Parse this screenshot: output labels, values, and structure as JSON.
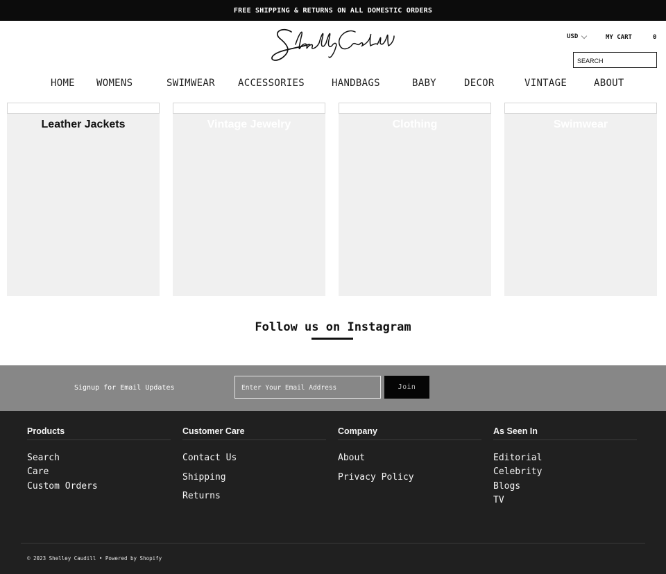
{
  "announcement": "FREE SHIPPING & RETURNS ON ALL DOMESTIC ORDERS",
  "header": {
    "currency": "USD",
    "cart_label": "MY CART",
    "cart_count": "0",
    "search_placeholder": "SEARCH"
  },
  "nav": [
    "HOME",
    "WOMENS",
    "SWIMWEAR",
    "ACCESSORIES",
    "HANDBAGS",
    "BABY",
    "DECOR",
    "VINTAGE",
    "ABOUT"
  ],
  "collections": [
    "Leather Jackets",
    "Vintage Jewelry",
    "Clothing",
    "Swimwear"
  ],
  "instagram_heading": "Follow us on Instagram",
  "signup": {
    "label": "Signup for Email Updates",
    "placeholder": "Enter Your Email Address",
    "button": "Join"
  },
  "footer": {
    "columns": [
      {
        "title": "Products",
        "links": [
          "Search",
          "Care",
          "Custom Orders"
        ]
      },
      {
        "title": "Customer Care",
        "links": [
          "Contact Us",
          "Shipping",
          "Returns"
        ]
      },
      {
        "title": "Company",
        "links": [
          "About",
          "Privacy Policy"
        ]
      },
      {
        "title": "As Seen In",
        "links": [
          "Editorial",
          "Celebrity",
          "Blogs",
          "TV"
        ]
      }
    ],
    "copyright": "© 2023 Shelley Caudill • Powered by Shopify"
  },
  "colors": {
    "announcement_bg": "#0c0c0c",
    "signup_bg": "#878787",
    "footer_bg": "#202020",
    "card_bg": "#f0f0f0"
  }
}
